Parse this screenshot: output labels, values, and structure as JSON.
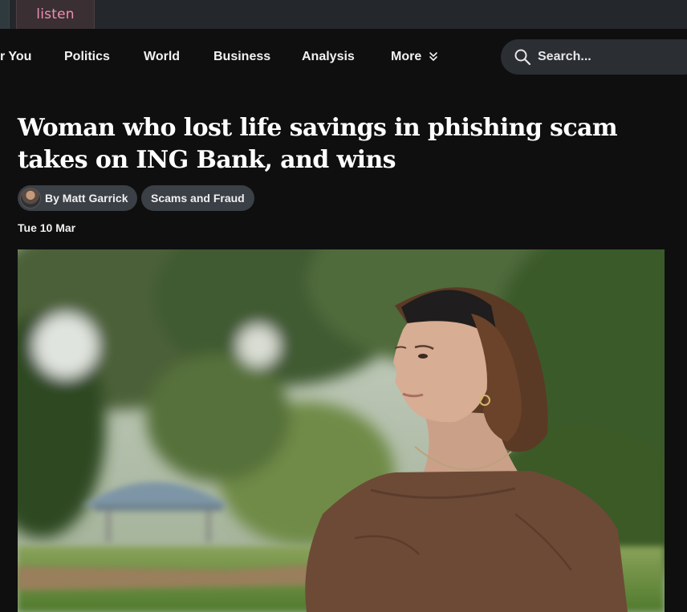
{
  "top": {
    "listen_label": "listen"
  },
  "nav": {
    "items": [
      "r You",
      "Politics",
      "World",
      "Business",
      "Analysis"
    ],
    "more_label": "More",
    "search_placeholder": "Search..."
  },
  "article": {
    "headline": "Woman who lost life savings in phishing scam takes on ING Bank, and wins",
    "author": "By Matt Garrick",
    "tag": "Scams and Fraud",
    "date": "Tue 10 Mar"
  },
  "colors": {
    "background": "#0f0f10",
    "pill": "#3b3f46",
    "listen_accent": "#ef8fb3"
  },
  "icons": [
    "search-icon",
    "chevron-down-icon",
    "avatar"
  ]
}
